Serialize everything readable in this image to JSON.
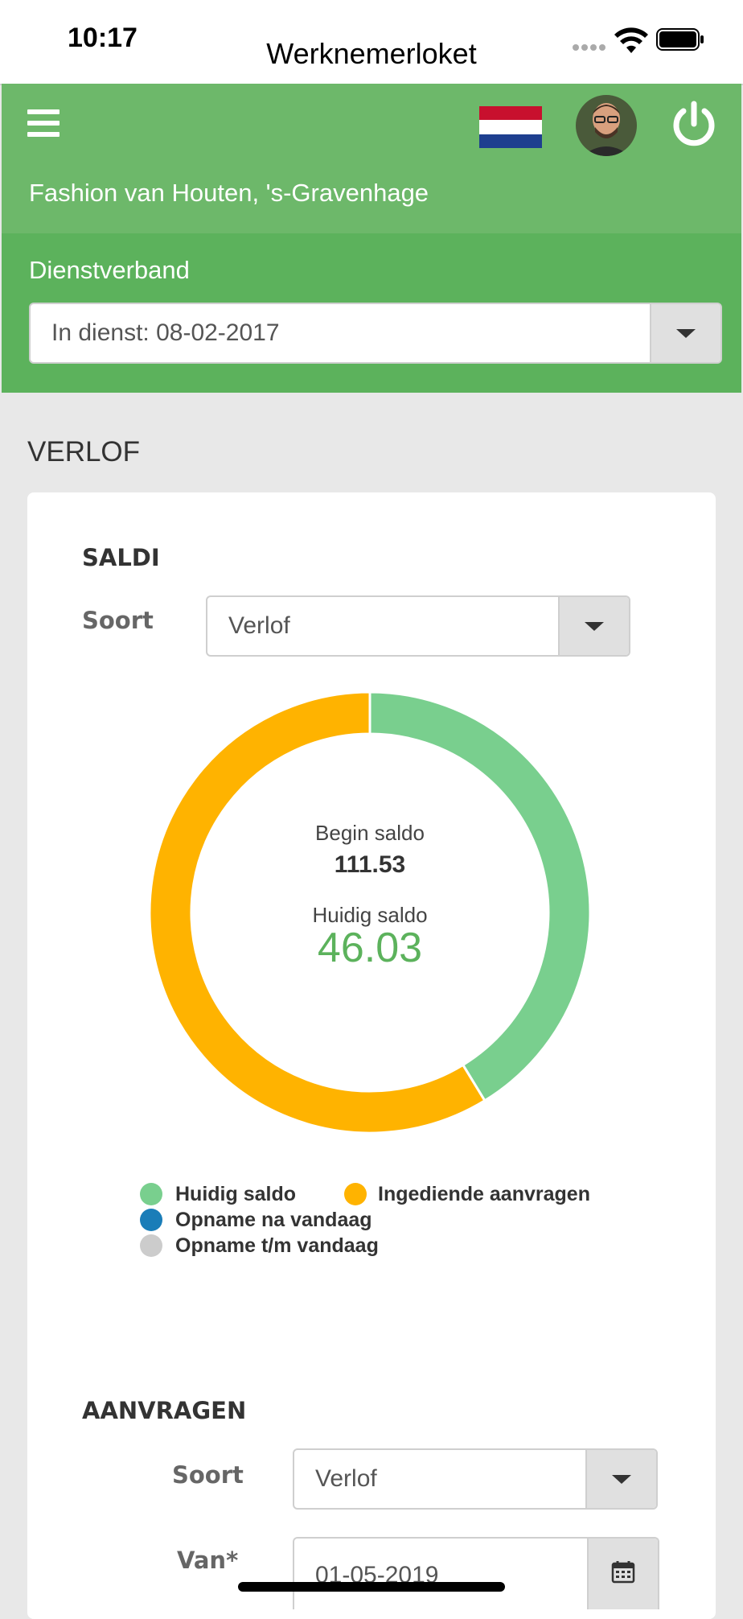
{
  "status_bar": {
    "time": "10:17",
    "app_title": "Werknemerloket"
  },
  "header": {
    "menu_icon": "hamburger-menu-icon",
    "language_icon": "dutch-flag-icon",
    "avatar_icon": "user-avatar",
    "logout_icon": "power-icon",
    "company": "Fashion van Houten, 's-Gravenhage",
    "employment_label": "Dienstverband",
    "employment_value": "In dienst: 08-02-2017"
  },
  "section_title": "VERLOF",
  "saldi": {
    "heading": "SALDI",
    "type_label": "Soort",
    "type_value": "Verlof"
  },
  "colors": {
    "header_green": "#5cb25c",
    "current_balance_green": "#79cf8e",
    "submitted_orange": "#ffb300",
    "after_today_blue": "#1a7db8",
    "until_today_grey": "#cccccc"
  },
  "chart_data": {
    "type": "pie",
    "style": "donut",
    "center": {
      "begin_label": "Begin saldo",
      "begin_value": "111.53",
      "current_label": "Huidig saldo",
      "current_value": "46.03"
    },
    "series": [
      {
        "name": "Huidig saldo",
        "value": 46.03,
        "color": "#79cf8e"
      },
      {
        "name": "Ingediende aanvragen",
        "value": 65.5,
        "color": "#ffb300"
      },
      {
        "name": "Opname na vandaag",
        "value": 0,
        "color": "#1a7db8"
      },
      {
        "name": "Opname t/m vandaag",
        "value": 0,
        "color": "#cccccc"
      }
    ],
    "legend_position": "bottom"
  },
  "aanvragen": {
    "heading": "AANVRAGEN",
    "type_label": "Soort",
    "type_value": "Verlof",
    "from_label": "Van*",
    "from_value": "01-05-2019",
    "calendar_icon": "calendar-icon"
  }
}
